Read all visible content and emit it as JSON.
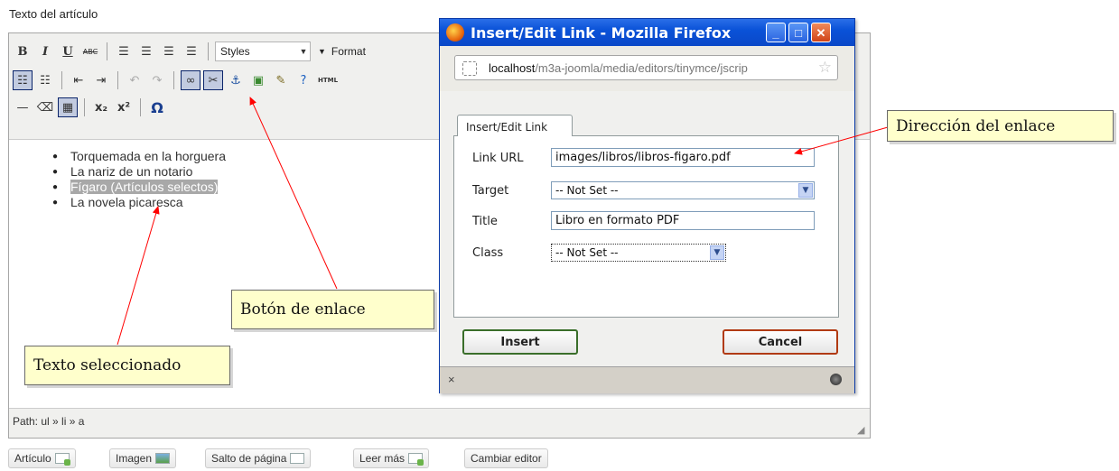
{
  "field_label": "Texto del artículo",
  "toolbar": {
    "styles_label": "Styles",
    "format_label": "Format",
    "html_label": "HTML"
  },
  "editor": {
    "items": [
      "Torquemada en la horguera",
      "La nariz de un notario",
      "Fígaro (Artículos selectos)",
      "La novela picaresca"
    ],
    "path": "Path: ul » li » a"
  },
  "bottom_buttons": [
    "Artículo",
    "Imagen",
    "Salto de página",
    "Leer más",
    "Cambiar editor"
  ],
  "dialog": {
    "window_title": "Insert/Edit Link - Mozilla Firefox",
    "url_host": "localhost",
    "url_path": "/m3a-joomla/media/editors/tinymce/jscrip",
    "tab": "Insert/Edit Link",
    "fields": {
      "link_url_label": "Link URL",
      "link_url_value": "images/libros/libros-figaro.pdf",
      "target_label": "Target",
      "target_value": "-- Not Set --",
      "title_label": "Title",
      "title_value": "Libro en formato PDF",
      "class_label": "Class",
      "class_value": "-- Not Set --"
    },
    "insert_label": "Insert",
    "cancel_label": "Cancel",
    "status_close": "×"
  },
  "callouts": {
    "direccion": "Dirección del enlace",
    "boton": "Botón de enlace",
    "texto": "Texto seleccionado"
  },
  "colors": {
    "callout_bg": "#ffffcc",
    "arrow": "#ff0000",
    "titlebar": "#0a52d8"
  }
}
